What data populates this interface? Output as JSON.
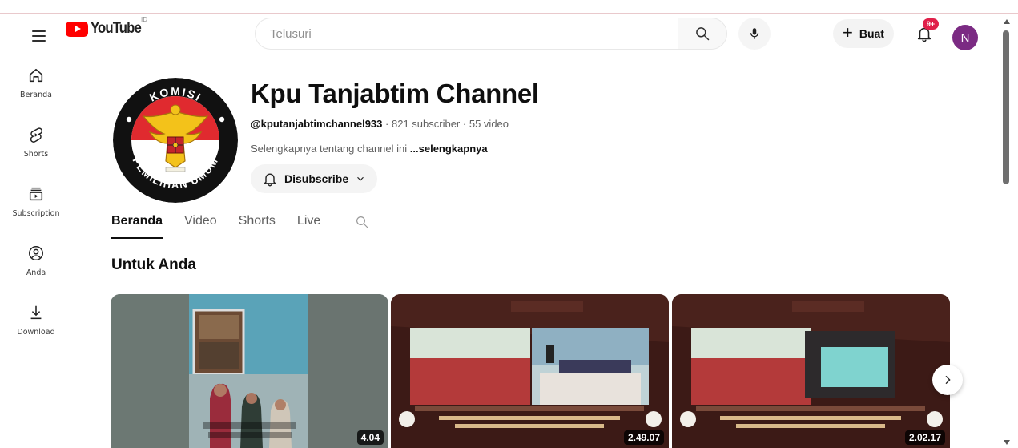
{
  "brand": {
    "logo_text": "YouTube",
    "region": "ID",
    "color": "#ff0000"
  },
  "search": {
    "placeholder": "Telusuri"
  },
  "header_actions": {
    "create_label": "Buat",
    "notification_badge": "9+",
    "avatar_initial": "N",
    "avatar_color": "#7b2b83"
  },
  "sidebar": {
    "items": [
      {
        "label": "Beranda",
        "icon": "home-icon"
      },
      {
        "label": "Shorts",
        "icon": "shorts-icon"
      },
      {
        "label": "Subscription",
        "icon": "subscriptions-icon"
      },
      {
        "label": "Anda",
        "icon": "you-icon"
      },
      {
        "label": "Download",
        "icon": "download-icon"
      }
    ]
  },
  "channel": {
    "name": "Kpu Tanjabtim Channel",
    "handle": "@kputanjabtimchannel933",
    "subscribers": "821 subscriber",
    "videos": "55 video",
    "meta_sep": "·",
    "about": "Selengkapnya tentang channel ini",
    "about_more": "...selengkapnya",
    "subscribe_label": "Disubscribe",
    "avatar_text_top": "KOMISI",
    "avatar_text_bottom": "PEMILIHAN UMUM"
  },
  "tabs": [
    {
      "label": "Beranda",
      "active": true
    },
    {
      "label": "Video",
      "active": false
    },
    {
      "label": "Shorts",
      "active": false
    },
    {
      "label": "Live",
      "active": false
    }
  ],
  "section": {
    "title": "Untuk Anda"
  },
  "videos": [
    {
      "duration": "4.04"
    },
    {
      "duration": "2.49.07"
    },
    {
      "duration": "2.02.17"
    }
  ]
}
